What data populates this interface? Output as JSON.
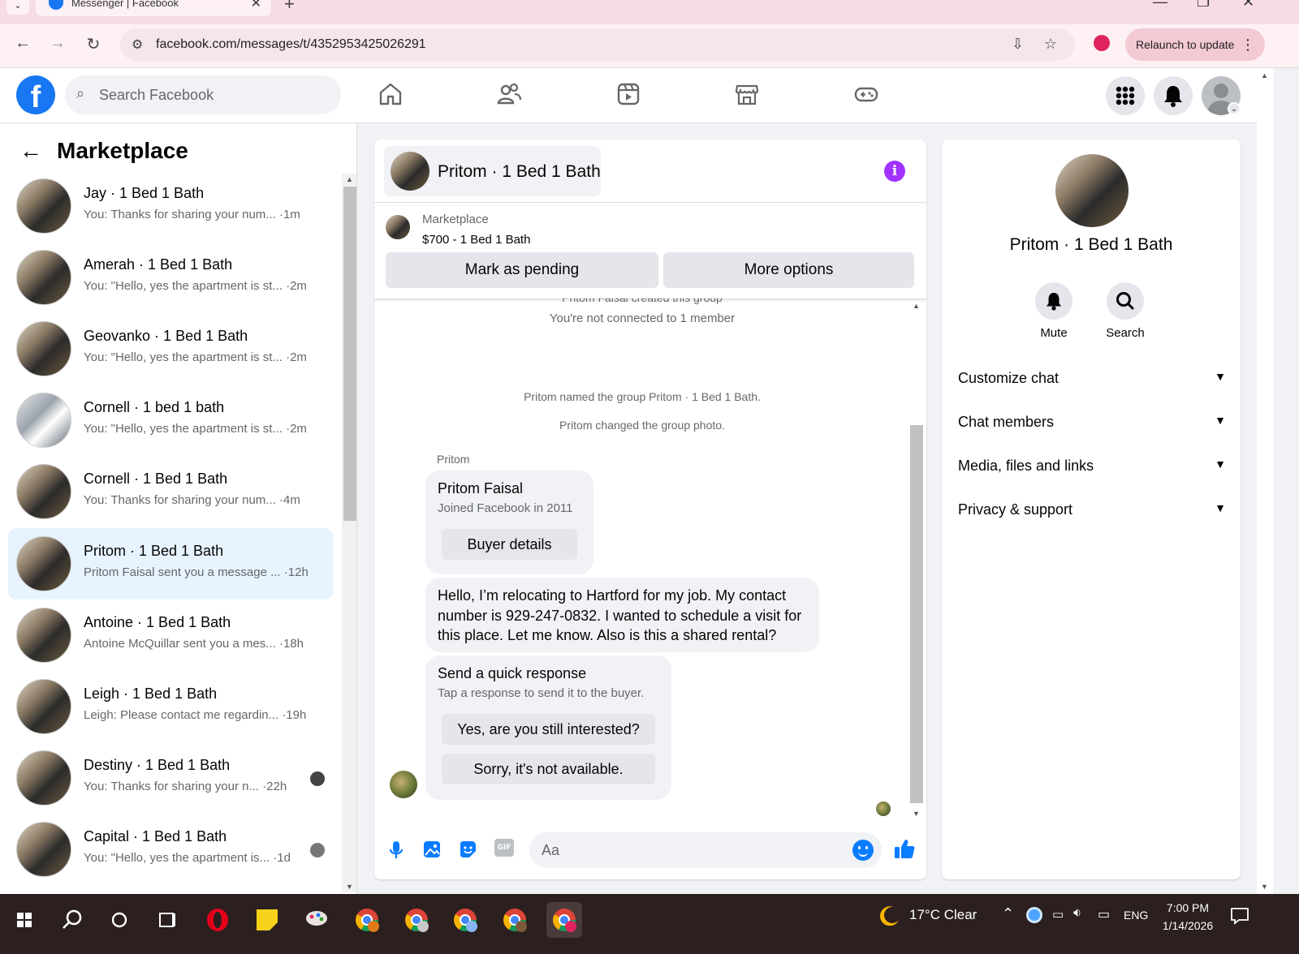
{
  "browser": {
    "tab_title": "Messenger | Facebook",
    "url": "facebook.com/messages/t/4352953425026291",
    "relaunch_label": "Relaunch to update"
  },
  "header": {
    "search_placeholder": "Search Facebook"
  },
  "left": {
    "title": "Marketplace",
    "conversations": [
      {
        "name": "Jay · 1 Bed 1 Bath",
        "snippet": "You: Thanks for sharing your num...",
        "time": "·1m"
      },
      {
        "name": "Amerah · 1 Bed 1 Bath",
        "snippet": "You: \"Hello, yes the apartment is st...",
        "time": "·2m"
      },
      {
        "name": "Geovanko · 1 Bed 1 Bath",
        "snippet": "You: \"Hello, yes the apartment is st...",
        "time": "·2m"
      },
      {
        "name": "Cornell · 1 bed 1 bath",
        "snippet": "You: \"Hello, yes the apartment is st...",
        "time": "·2m"
      },
      {
        "name": "Cornell · 1 Bed 1 Bath",
        "snippet": "You: Thanks for sharing your num...",
        "time": "·4m"
      },
      {
        "name": "Pritom · 1 Bed 1 Bath",
        "snippet": "Pritom Faisal sent you a message ...",
        "time": "·12h"
      },
      {
        "name": "Antoine · 1 Bed 1 Bath",
        "snippet": "Antoine McQuillar sent you a mes...",
        "time": "·18h"
      },
      {
        "name": "Leigh · 1 Bed 1 Bath",
        "snippet": "Leigh: Please contact me regardin...",
        "time": "·19h"
      },
      {
        "name": "Destiny · 1 Bed 1 Bath",
        "snippet": "You: Thanks for sharing your n...",
        "time": "·22h"
      },
      {
        "name": "Capital · 1 Bed 1 Bath",
        "snippet": "You: \"Hello, yes the apartment is...",
        "time": "·1d"
      }
    ]
  },
  "chat": {
    "title": "Pritom · 1 Bed 1 Bath",
    "marketplace_label": "Marketplace",
    "listing": "$700 - 1 Bed 1 Bath",
    "mark_pending": "Mark as pending",
    "more_options": "More options",
    "sys_partial": "Pritom Faisal created this group",
    "sys_not_connected": "You're not connected to 1 member",
    "sys_named": "Pritom named the group Pritom · 1 Bed 1 Bath.",
    "sys_photo": "Pritom changed the group photo.",
    "sender": "Pritom",
    "card_name": "Pritom Faisal",
    "card_joined": "Joined Facebook in 2011",
    "buyer_details": "Buyer details",
    "message": "Hello, I’m relocating to Hartford for my job. My contact number is 929-247-0832. I wanted to schedule a visit for this place. Let me know. Also is this a shared rental?",
    "quick_title": "Send a quick response",
    "quick_sub": "Tap a response to send it to the buyer.",
    "quick_1": "Yes, are you still interested?",
    "quick_2": "Sorry, it's not available.",
    "input_placeholder": "Aa"
  },
  "info": {
    "name": "Pritom · 1 Bed 1 Bath",
    "mute": "Mute",
    "search": "Search",
    "sections": [
      "Customize chat",
      "Chat members",
      "Media, files and links",
      "Privacy & support"
    ]
  },
  "taskbar": {
    "weather": "17°C  Clear",
    "lang": "ENG",
    "time": "7:00 PM",
    "date": "1/14/2026"
  },
  "colors": {
    "fb_blue": "#1877f2",
    "messenger_blue": "#0a7cff",
    "info_purple": "#a033ff",
    "active_row": "#e7f3ff"
  }
}
